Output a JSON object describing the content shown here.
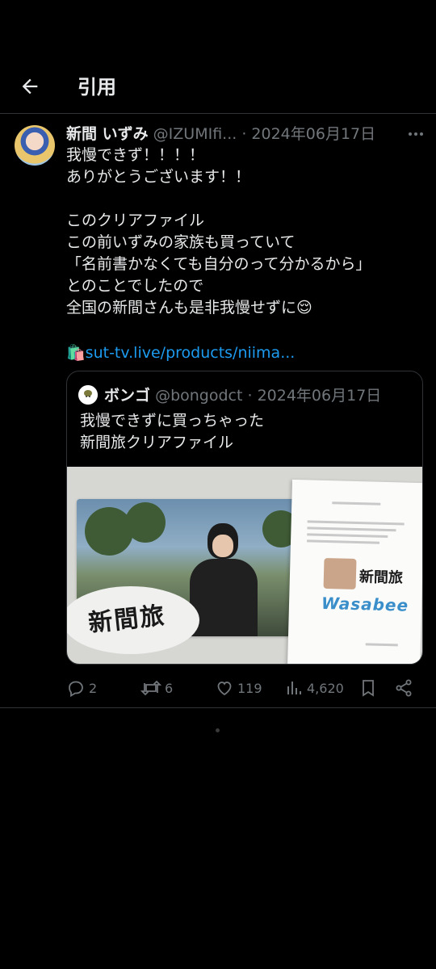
{
  "header": {
    "title": "引用"
  },
  "tweet": {
    "name": "新間 いずみ",
    "handle": "@IZUMIfi...",
    "date": "2024年06月17日",
    "lines": [
      "我慢できず！！！！",
      "ありがとうございます！！",
      "",
      "このクリアファイル",
      "この前いずみの家族も買っていて",
      "「名前書かなくても自分のって分かるから」",
      "とのことでしたので",
      "全国の新間さんも是非我慢せずに😌"
    ],
    "link_emoji": "🛍️",
    "link": "sut-tv.live/products/niima..."
  },
  "quote": {
    "name": "ボンゴ",
    "handle": "@bongodct",
    "date": "2024年06月17日",
    "lines": [
      "我慢できずに買っちゃった",
      "新間旅クリアファイル"
    ],
    "media": {
      "folder_logo": "新間旅",
      "paper_logo": "新間旅",
      "paper_brand": "Wasabee"
    }
  },
  "actions": {
    "reply_count": "2",
    "retweet_count": "6",
    "like_count": "119",
    "view_count": "4,620"
  },
  "colors": {
    "accent": "#1d9bf0",
    "muted": "#71767b",
    "background": "#000000",
    "divider": "#2f3336"
  }
}
